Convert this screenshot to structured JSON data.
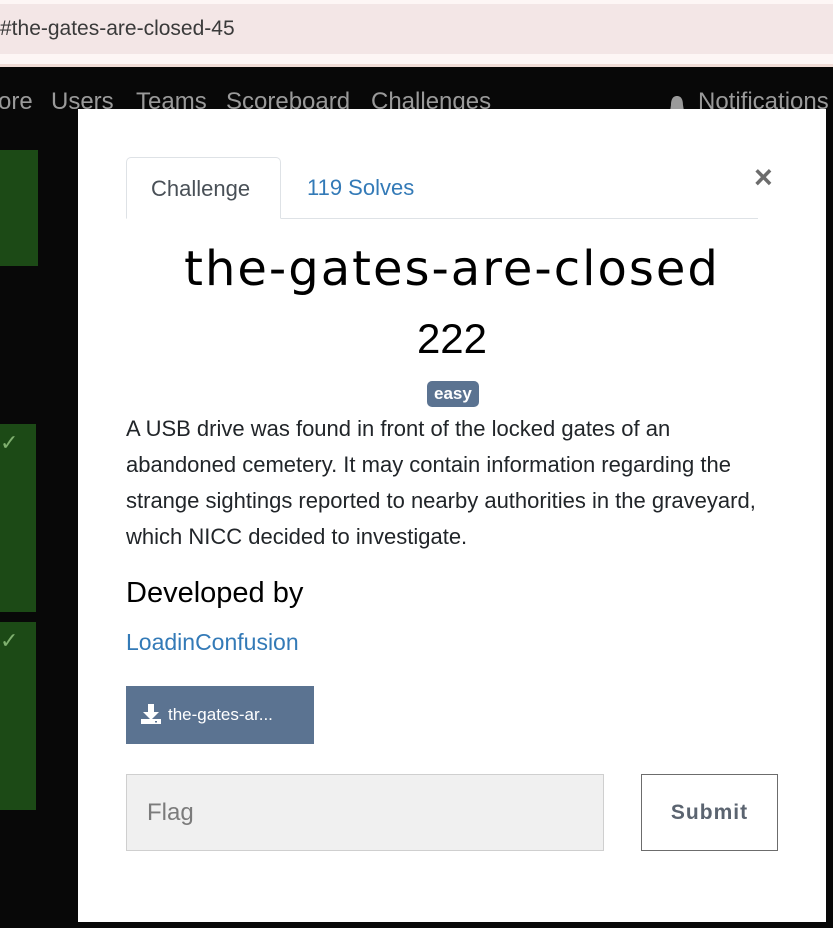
{
  "browser": {
    "url_fragment": "#the-gates-are-closed-45"
  },
  "navbar": {
    "items": [
      "ore",
      "Users",
      "Teams",
      "Scoreboard",
      "Challenges"
    ],
    "notifications": "Notifications"
  },
  "modal": {
    "tabs": [
      {
        "label": "Challenge"
      },
      {
        "label": "119 Solves"
      }
    ],
    "close_label": "×",
    "title": "the-gates-are-closed",
    "points": "222",
    "difficulty_badge": "easy",
    "description": "A USB drive was found in front of the locked gates of an abandoned cemetery. It may contain information regarding the strange sightings reported to nearby authorities in the graveyard, which NICC decided to investigate.",
    "developed_by_heading": "Developed by",
    "developer": "LoadinConfusion",
    "download_label": "the-gates-ar...",
    "flag_placeholder": "Flag",
    "submit_label": "Submit"
  },
  "colors": {
    "badge": "#5b7391",
    "link": "#337ab7",
    "card_green": "#1c4a16"
  }
}
